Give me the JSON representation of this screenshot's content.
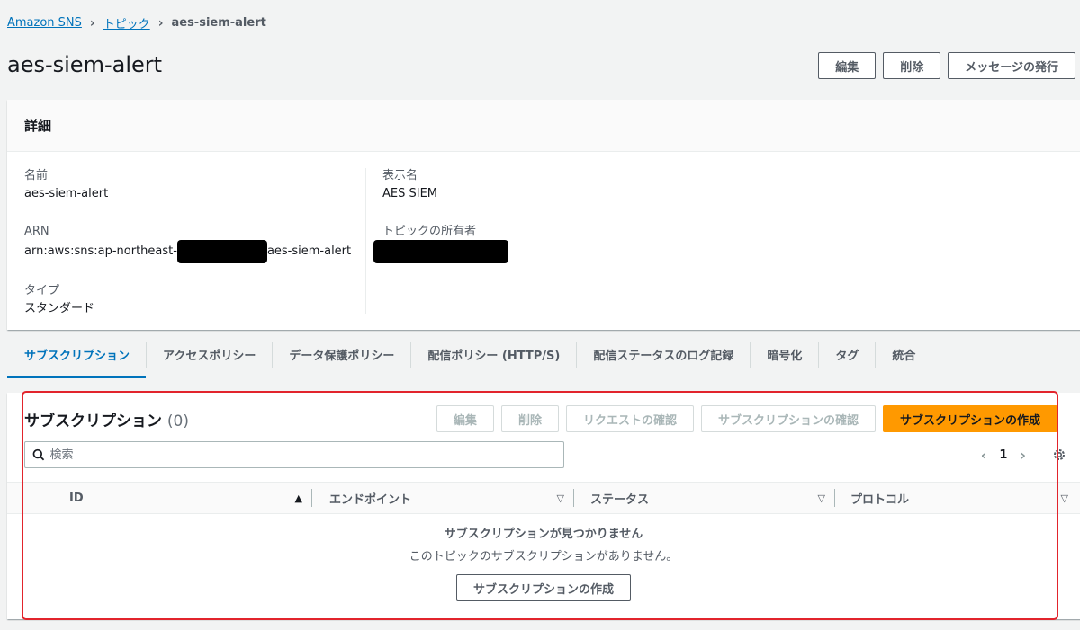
{
  "breadcrumb": {
    "root": "Amazon SNS",
    "topics": "トピック",
    "current": "aes-siem-alert"
  },
  "header": {
    "title": "aes-siem-alert",
    "edit": "編集",
    "delete": "削除",
    "publish": "メッセージの発行"
  },
  "details": {
    "heading": "詳細",
    "name_label": "名前",
    "name_value": "aes-siem-alert",
    "arn_label": "ARN",
    "arn_prefix": "arn:aws:sns:ap-northeast-",
    "arn_suffix": "aes-siem-alert",
    "type_label": "タイプ",
    "type_value": "スタンダード",
    "display_name_label": "表示名",
    "display_name_value": "AES SIEM",
    "owner_label": "トピックの所有者"
  },
  "tabs": [
    {
      "label": "サブスクリプション"
    },
    {
      "label": "アクセスポリシー"
    },
    {
      "label": "データ保護ポリシー"
    },
    {
      "label": "配信ポリシー (HTTP/S)"
    },
    {
      "label": "配信ステータスのログ記録"
    },
    {
      "label": "暗号化"
    },
    {
      "label": "タグ"
    },
    {
      "label": "統合"
    }
  ],
  "subscriptions": {
    "title": "サブスクリプション",
    "count": "(0)",
    "edit": "編集",
    "delete": "削除",
    "confirm_request": "リクエストの確認",
    "confirm_subscription": "サブスクリプションの確認",
    "create": "サブスクリプションの作成",
    "search_placeholder": "検索",
    "page": "1",
    "columns": [
      "ID",
      "エンドポイント",
      "ステータス",
      "プロトコル"
    ],
    "empty_title": "サブスクリプションが見つかりません",
    "empty_desc": "このトピックのサブスクリプションがありません。",
    "empty_button": "サブスクリプションの作成"
  },
  "colors": {
    "accent": "#0073bb",
    "primary_button": "#ff9900",
    "highlight_border": "#e2242c"
  }
}
